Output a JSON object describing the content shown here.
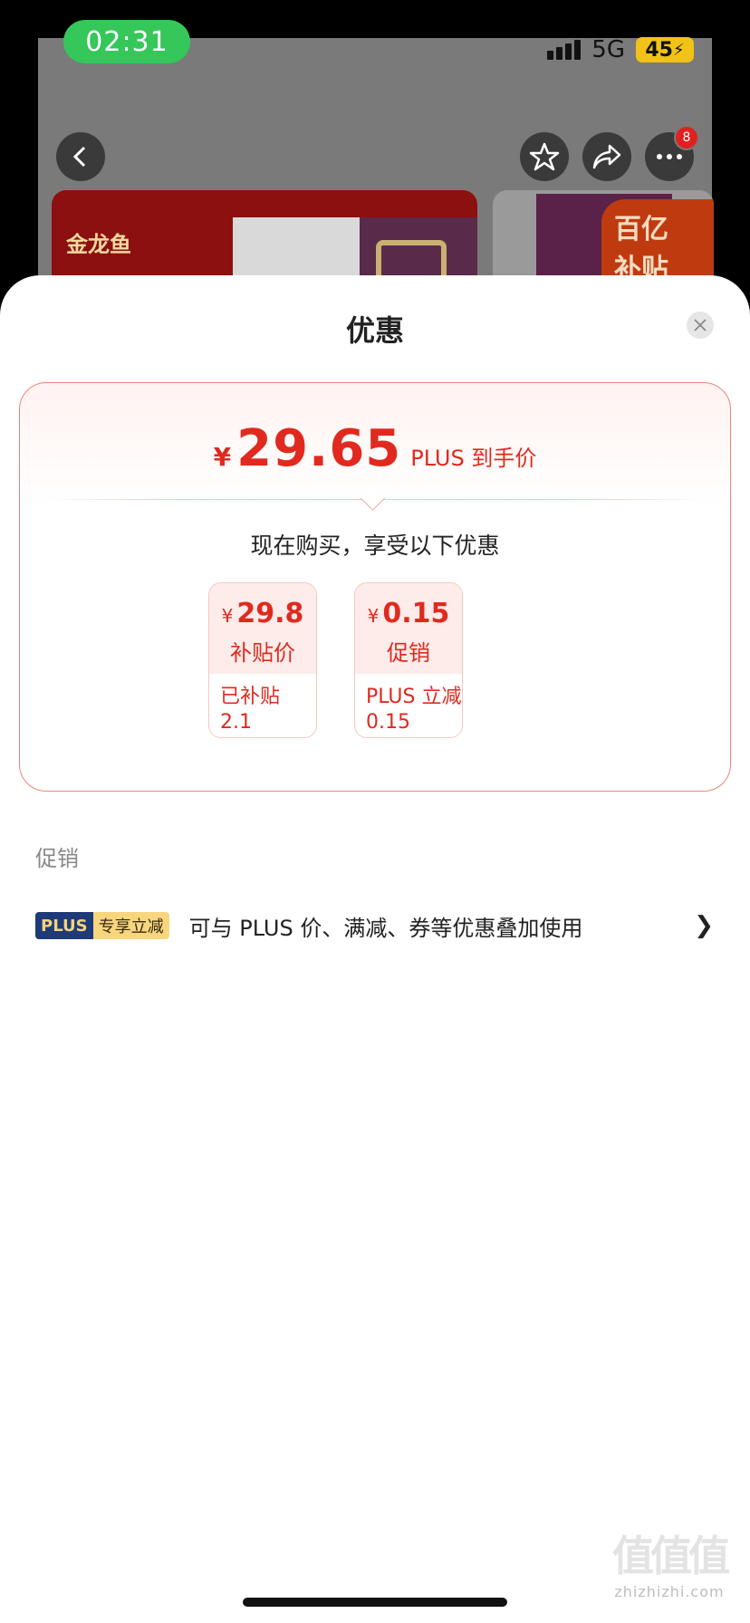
{
  "status": {
    "time": "02:31",
    "network": "5G",
    "battery": "45"
  },
  "nav": {
    "cart_badge": "8",
    "icons": [
      "back-icon",
      "star-icon",
      "share-icon",
      "more-icon"
    ]
  },
  "background": {
    "brand": "金龙鱼",
    "subsidy_tag_line1": "百亿",
    "subsidy_tag_line2": "补贴"
  },
  "sheet": {
    "title": "优惠",
    "final_price": {
      "currency": "¥",
      "amount": "29.65",
      "label": "PLUS 到手价"
    },
    "buy_text": "现在购买，享受以下优惠",
    "deals": [
      {
        "currency": "¥",
        "amount": "29.8",
        "label": "补贴价",
        "detail_line1": "已补贴",
        "detail_line2": "2.1"
      },
      {
        "currency": "¥",
        "amount": "0.15",
        "label": "促销",
        "detail_line1": "PLUS 立减",
        "detail_line2": "0.15"
      }
    ],
    "section_label": "促销",
    "promo": {
      "badge_left": "PLUS",
      "badge_right": "专享立减",
      "text": "可与 PLUS 价、满减、券等优惠叠加使用",
      "chevron": "❯"
    }
  },
  "watermark": {
    "icon": "值值值",
    "text": "zhizhizhi.com"
  },
  "colors": {
    "accent": "#e02a1f",
    "plus_blue": "#1e3a78",
    "plus_gold": "#f7d67e"
  }
}
